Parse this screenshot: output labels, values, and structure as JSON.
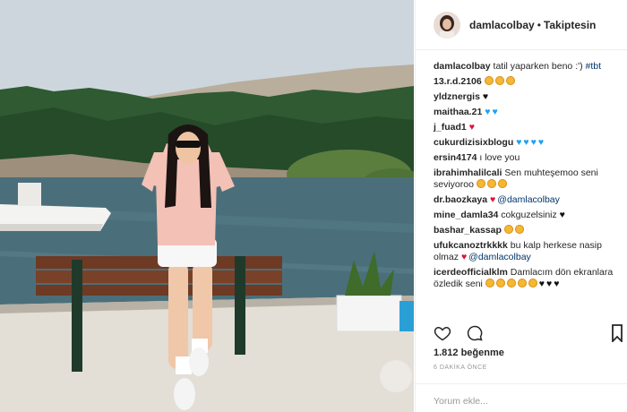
{
  "post": {
    "username": "damlacolbay",
    "separator": "•",
    "follow_status": "Takiptesin"
  },
  "caption": {
    "username": "damlacolbay",
    "text": "tatil yaparken beno :')",
    "hashtag": "#tbt"
  },
  "comments": [
    {
      "user": "13.r.d.2106",
      "text": "",
      "emoji": [
        "face",
        "face",
        "face"
      ]
    },
    {
      "user": "yldznergis",
      "text": "",
      "emoji": [
        "heart-blk"
      ]
    },
    {
      "user": "maithaa.21",
      "text": "",
      "emoji": [
        "heart-blue",
        "heart-blue"
      ]
    },
    {
      "user": "j_fuad1",
      "text": "",
      "emoji": [
        "heart-red"
      ]
    },
    {
      "user": "cukurdizisixblogu",
      "text": "",
      "emoji": [
        "heart-blue",
        "heart-blue",
        "heart-blue",
        "heart-blue"
      ]
    },
    {
      "user": "ersin4174",
      "text": "ı love you",
      "emoji": []
    },
    {
      "user": "ibrahimhalilcali",
      "text": "Sen muhteşemoo seni seviyoroo",
      "emoji": [
        "face",
        "face",
        "face"
      ]
    },
    {
      "user": "dr.baozkaya",
      "text": "",
      "mention": "@damlacolbay",
      "emoji": [
        "heart-red"
      ]
    },
    {
      "user": "mine_damla34",
      "text": "cokguzelsiniz",
      "emoji": [
        "heart-blk"
      ]
    },
    {
      "user": "bashar_kassap",
      "text": "",
      "emoji": [
        "face",
        "face"
      ]
    },
    {
      "user": "ufukcanoztrkkkk",
      "text": "bu kalp herkese nasip olmaz",
      "mention": "@damlacolbay",
      "emoji": [
        "heart-red"
      ]
    },
    {
      "user": "icerdeofficialklm",
      "text": "Damlacım dön ekranlara özledik seni",
      "emoji": [
        "face",
        "face",
        "face",
        "face",
        "face",
        "heart-blk",
        "heart-blk",
        "heart-blk"
      ]
    }
  ],
  "actions": {
    "like_icon": "heart-outline-icon",
    "comment_icon": "comment-bubble-icon",
    "save_icon": "bookmark-icon"
  },
  "likes_text": "1.812 beğenme",
  "time_text": "6 DAKİKA ÖNCE",
  "add_comment_placeholder": "Yorum ekle...",
  "colors": {
    "link": "#003569",
    "text": "#262626",
    "muted": "#999999"
  }
}
